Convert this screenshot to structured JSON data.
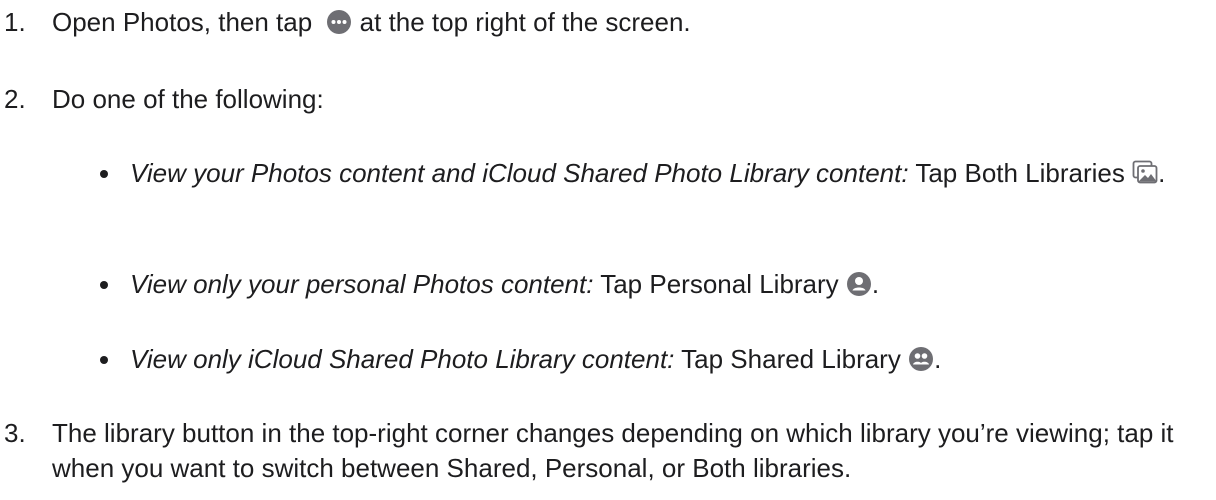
{
  "steps": [
    {
      "number": "1.",
      "text_before_icon": "Open Photos, then tap",
      "icon": "more-circle-icon",
      "text_after_icon": " at the top right of the screen."
    },
    {
      "number": "2.",
      "text": "Do one of the following:"
    },
    {
      "number": "3.",
      "text": "The library button in the top-right corner changes depending on which library you’re viewing; tap it when you want to switch between Shared, Personal, or Both libraries."
    }
  ],
  "options": [
    {
      "italic": "View your Photos content and iCloud Shared Photo Library content:",
      "text": " Tap Both Libraries",
      "icon": "both-libraries-icon",
      "suffix": "."
    },
    {
      "italic": "View only your personal Photos content:",
      "text": " Tap Personal Library",
      "icon": "personal-library-icon",
      "suffix": "."
    },
    {
      "italic": "View only iCloud Shared Photo Library content:",
      "text": " Tap Shared Library",
      "icon": "shared-library-icon",
      "suffix": "."
    }
  ],
  "colors": {
    "text": "#1d1d1f",
    "icon": "#6e6e73",
    "background": "#ffffff"
  }
}
